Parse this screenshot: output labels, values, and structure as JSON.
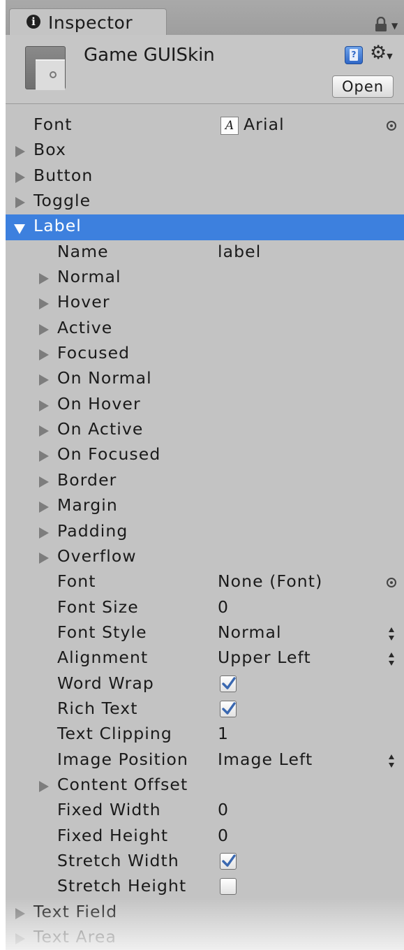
{
  "tab": {
    "label": "Inspector",
    "icon": "info-icon"
  },
  "asset": {
    "title": "Game GUISkin",
    "open_label": "Open"
  },
  "rows": [
    {
      "label": "Font",
      "indent": 0,
      "kind": "object",
      "value": "Arial",
      "icon": "font-asset-icon"
    },
    {
      "label": "Box",
      "indent": 0,
      "kind": "foldout"
    },
    {
      "label": "Button",
      "indent": 0,
      "kind": "foldout"
    },
    {
      "label": "Toggle",
      "indent": 0,
      "kind": "foldout"
    },
    {
      "label": "Label",
      "indent": 0,
      "kind": "foldout-open",
      "selected": true
    },
    {
      "label": "Name",
      "indent": 1,
      "kind": "text",
      "value": "label"
    },
    {
      "label": "Normal",
      "indent": 1,
      "kind": "foldout"
    },
    {
      "label": "Hover",
      "indent": 1,
      "kind": "foldout"
    },
    {
      "label": "Active",
      "indent": 1,
      "kind": "foldout"
    },
    {
      "label": "Focused",
      "indent": 1,
      "kind": "foldout"
    },
    {
      "label": "On Normal",
      "indent": 1,
      "kind": "foldout"
    },
    {
      "label": "On Hover",
      "indent": 1,
      "kind": "foldout"
    },
    {
      "label": "On Active",
      "indent": 1,
      "kind": "foldout"
    },
    {
      "label": "On Focused",
      "indent": 1,
      "kind": "foldout"
    },
    {
      "label": "Border",
      "indent": 1,
      "kind": "foldout"
    },
    {
      "label": "Margin",
      "indent": 1,
      "kind": "foldout"
    },
    {
      "label": "Padding",
      "indent": 1,
      "kind": "foldout"
    },
    {
      "label": "Overflow",
      "indent": 1,
      "kind": "foldout"
    },
    {
      "label": "Font",
      "indent": 1,
      "kind": "object",
      "value": "None (Font)"
    },
    {
      "label": "Font Size",
      "indent": 1,
      "kind": "text",
      "value": "0"
    },
    {
      "label": "Font Style",
      "indent": 1,
      "kind": "popup",
      "value": "Normal"
    },
    {
      "label": "Alignment",
      "indent": 1,
      "kind": "popup",
      "value": "Upper Left"
    },
    {
      "label": "Word Wrap",
      "indent": 1,
      "kind": "toggle",
      "checked": true
    },
    {
      "label": "Rich Text",
      "indent": 1,
      "kind": "toggle",
      "checked": true
    },
    {
      "label": "Text Clipping",
      "indent": 1,
      "kind": "text",
      "value": "1"
    },
    {
      "label": "Image Position",
      "indent": 1,
      "kind": "popup",
      "value": "Image Left"
    },
    {
      "label": "Content Offset",
      "indent": 1,
      "kind": "foldout"
    },
    {
      "label": "Fixed Width",
      "indent": 1,
      "kind": "text",
      "value": "0"
    },
    {
      "label": "Fixed Height",
      "indent": 1,
      "kind": "text",
      "value": "0"
    },
    {
      "label": "Stretch Width",
      "indent": 1,
      "kind": "toggle",
      "checked": true
    },
    {
      "label": "Stretch Height",
      "indent": 1,
      "kind": "toggle",
      "checked": false
    },
    {
      "label": "Text Field",
      "indent": 0,
      "kind": "foldout"
    },
    {
      "label": "Text Area",
      "indent": 0,
      "kind": "foldout",
      "dimmed": true
    }
  ],
  "colors": {
    "selection": "#3d80de",
    "panel": "#c3c3c3",
    "checkmark": "#3a68b0"
  }
}
